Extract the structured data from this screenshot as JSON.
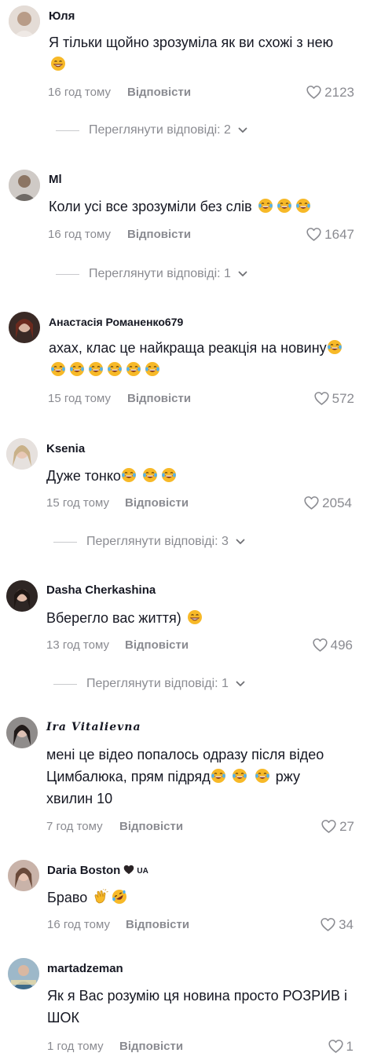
{
  "comments": [
    {
      "author": "Юля",
      "text": "Я тільки щойно зрозуміла як ви схожі з нею",
      "time": "16 год тому",
      "reply_label": "Відповісти",
      "likes": "2123",
      "view_replies": "Переглянути відповіді: 2"
    },
    {
      "author": "Ml",
      "text": "Коли усі все зрозуміли без слів",
      "time": "16 год тому",
      "reply_label": "Відповісти",
      "likes": "1647",
      "view_replies": "Переглянути відповіді: 1"
    },
    {
      "author": "Анастасія Романенко679",
      "text": "ахах, клас це найкраща реакція на новину",
      "time": "15 год тому",
      "reply_label": "Відповісти",
      "likes": "572"
    },
    {
      "author": "Ksenia",
      "text": "Дуже тонко",
      "time": "15 год тому",
      "reply_label": "Відповісти",
      "likes": "2054",
      "view_replies": "Переглянути відповіді: 3"
    },
    {
      "author": "Dasha Cherkashina",
      "text": "Вберегло вас життя)",
      "time": "13 год тому",
      "reply_label": "Відповісти",
      "likes": "496",
      "view_replies": "Переглянути відповіді: 1"
    },
    {
      "author": "𝑰𝒓𝒂 𝑽𝒊𝒕𝒂𝒍𝒊𝒆𝒗𝒏𝒂",
      "text_line1": "мені це відео попалось одразу після відео",
      "text_line2a": "Цимбалюка, прям підряд",
      "text_line2b": "ржу",
      "text_line3": "хвилин 10",
      "time": "7 год тому",
      "reply_label": "Відповісти",
      "likes": "27"
    },
    {
      "author": "Daria Boston",
      "author_badge": "UA",
      "text": "Браво",
      "time": "16 год тому",
      "reply_label": "Відповісти",
      "likes": "34"
    },
    {
      "author": "martadzeman",
      "text_line1": "Як я Вас розумію ця новина просто РОЗРИВ і",
      "text_line2": "ШОК",
      "time": "1 год тому",
      "reply_label": "Відповісти",
      "likes": "1"
    }
  ],
  "icons": {
    "like": "heart-outline-icon",
    "expand": "chevron-down-icon",
    "emoji_laugh": "tears-of-joy-emoji",
    "emoji_grin": "grinning-emoji",
    "emoji_clap": "clapping-hands-emoji",
    "emoji_rofl": "rolling-laughing-emoji"
  },
  "colors": {
    "text": "#161823",
    "muted": "#8a8b91",
    "emoji": "#f7b928"
  }
}
